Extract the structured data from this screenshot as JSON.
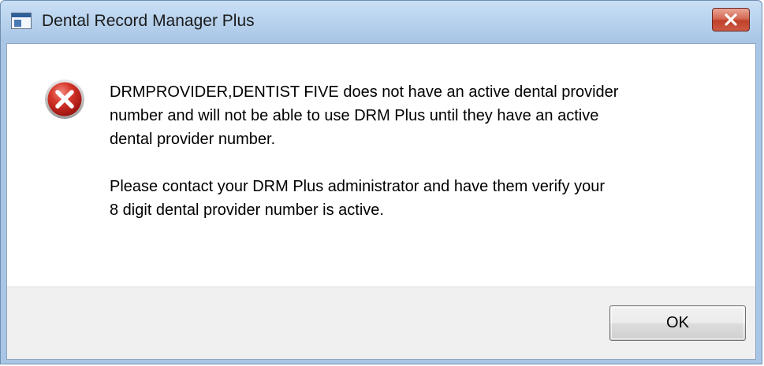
{
  "window": {
    "title": "Dental Record Manager Plus",
    "close_icon": "close-icon"
  },
  "dialog": {
    "icon": "error-icon",
    "message_paragraph_1": "DRMPROVIDER,DENTIST FIVE does not have an active dental provider\nnumber and will not be able to use DRM Plus until they have an active\ndental provider number.",
    "message_paragraph_2": "Please contact your DRM Plus administrator and have them verify your\n8 digit dental provider number is active.",
    "ok_label": "OK"
  },
  "colors": {
    "error_red": "#c8261f",
    "titlebar_blue": "#b9d3ee",
    "footer_gray": "#f0f0f0"
  }
}
